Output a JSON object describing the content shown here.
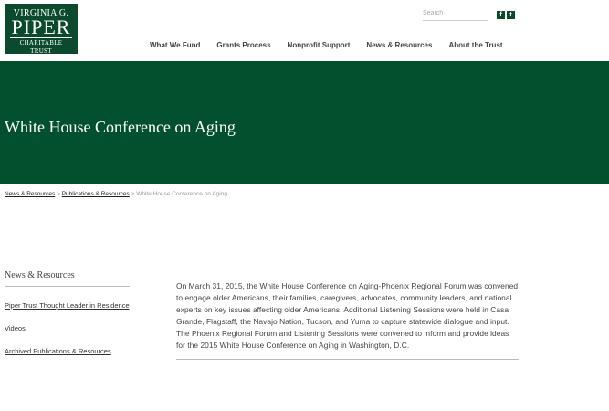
{
  "logo": {
    "line1": "VIRGINIA G.",
    "line2": "PIPER",
    "line3": "CHARITABLE TRUST"
  },
  "search": {
    "placeholder": "Search"
  },
  "social": {
    "facebook": "f",
    "twitter": "t"
  },
  "nav": [
    "What We Fund",
    "Grants Process",
    "Nonprofit Support",
    "News & Resources",
    "About the Trust"
  ],
  "hero": {
    "title": "White House Conference on Aging"
  },
  "breadcrumb": {
    "items": [
      "News & Resources",
      "Publications & Resources"
    ],
    "separator": ">",
    "current": "White House Conference on Aging"
  },
  "sidebar": {
    "title": "News & Resources",
    "links": [
      "Piper Trust Thought Leader in Residence",
      "Videos",
      "Archived Publications & Resources"
    ]
  },
  "content": {
    "body": "On March 31, 2015, the White House Conference on Aging-Phoenix Regional Forum was convened to engage older Americans, their families, caregivers, advocates, community leaders, and national experts on key issues affecting older Americans. Additional Listening Sessions were held in Casa Grande, Flagstaff, the Navajo Nation, Tucson, and Yuma to capture statewide dialogue and input. The Phoenix Regional Forum and Listening Sessions were convened to inform and provide ideas for the 2015 White House Conference on Aging in Washington, D.C."
  },
  "colors": {
    "brand_green": "#03502e",
    "logo_green": "#0b4a2c"
  }
}
